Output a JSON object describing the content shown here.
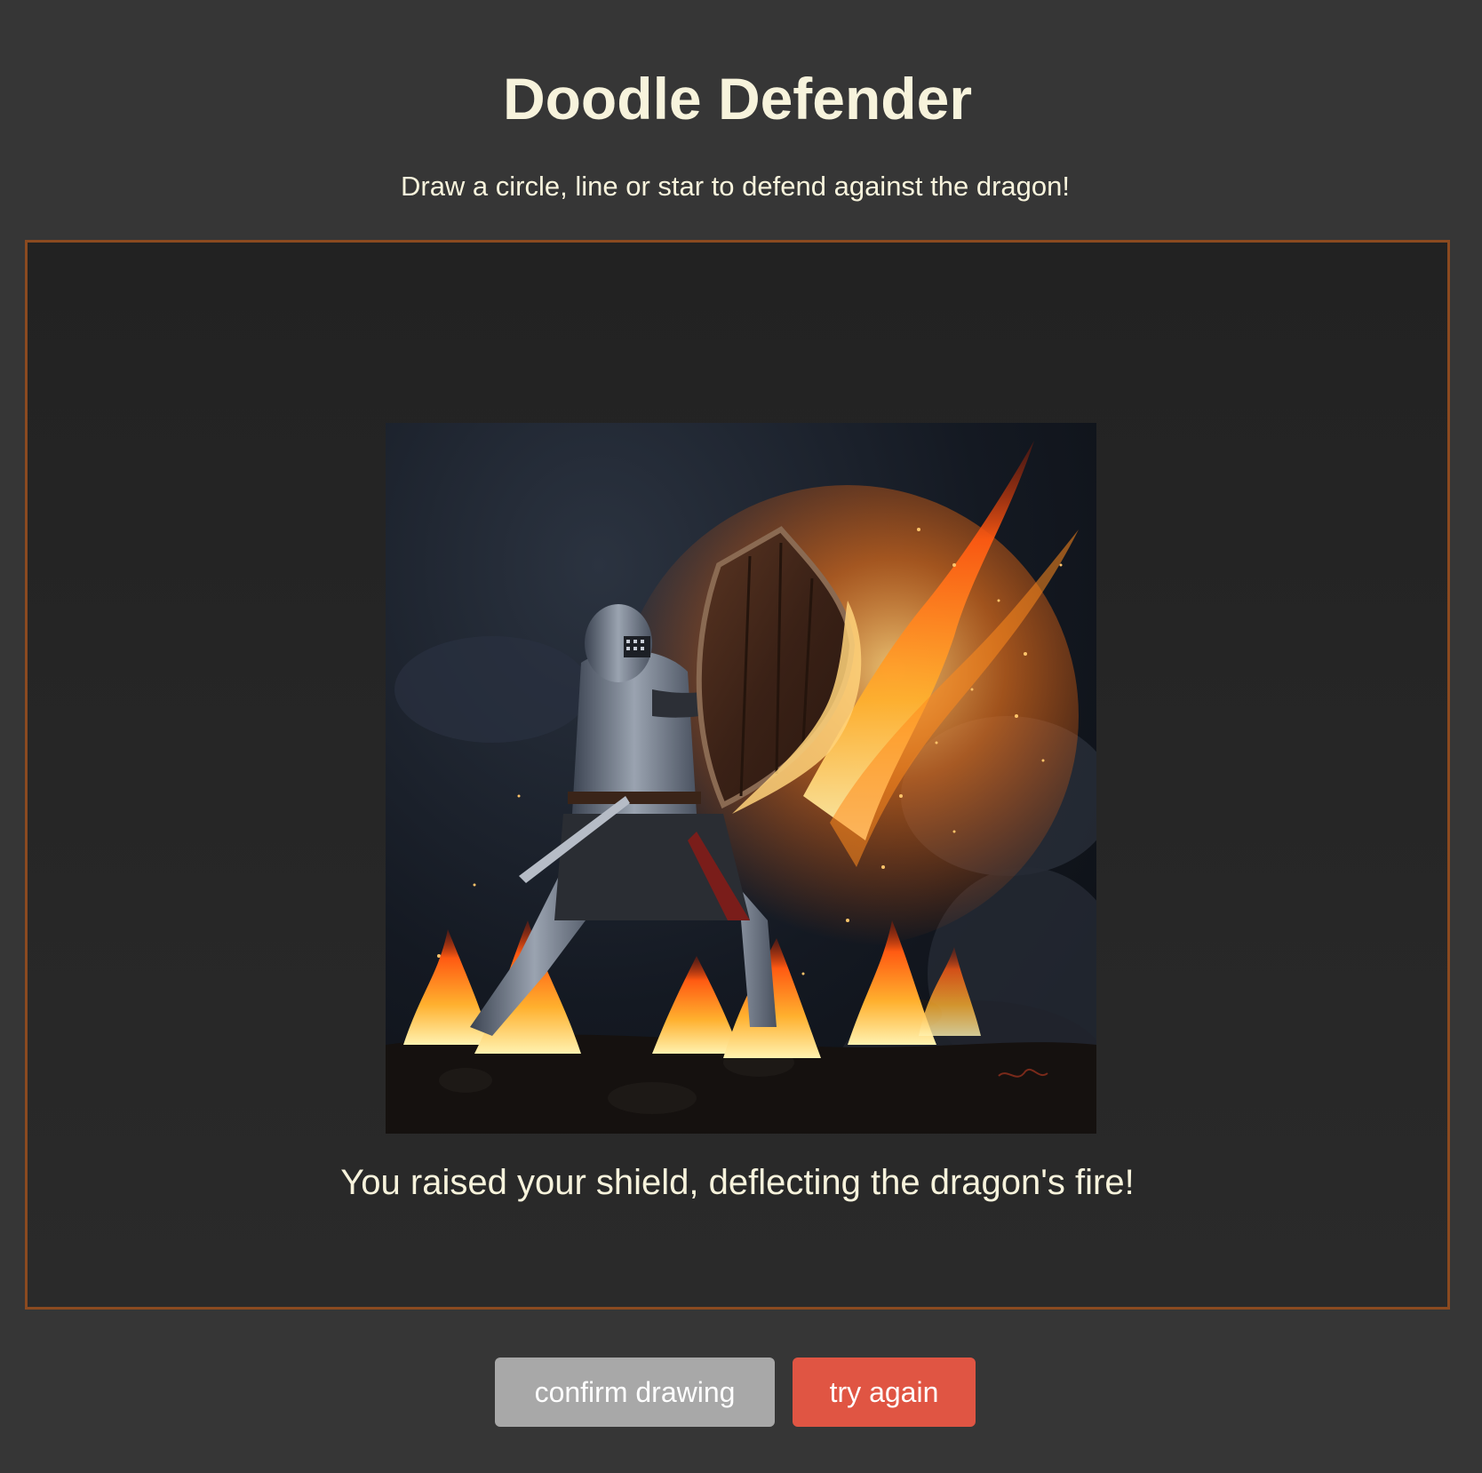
{
  "header": {
    "title": "Doodle Defender",
    "instructions": "Draw a circle, line or star to defend against the dragon!"
  },
  "game": {
    "scene_image": "knight-blocking-dragon-fire",
    "result_message": "You raised your shield, deflecting the dragon's fire!"
  },
  "controls": {
    "confirm_label": "confirm drawing",
    "retry_label": "try again"
  },
  "colors": {
    "background": "#363636",
    "stage_border": "#8b4a20",
    "text": "#f7f3dc",
    "confirm_button": "#a8a8a8",
    "retry_button": "#e05543"
  }
}
